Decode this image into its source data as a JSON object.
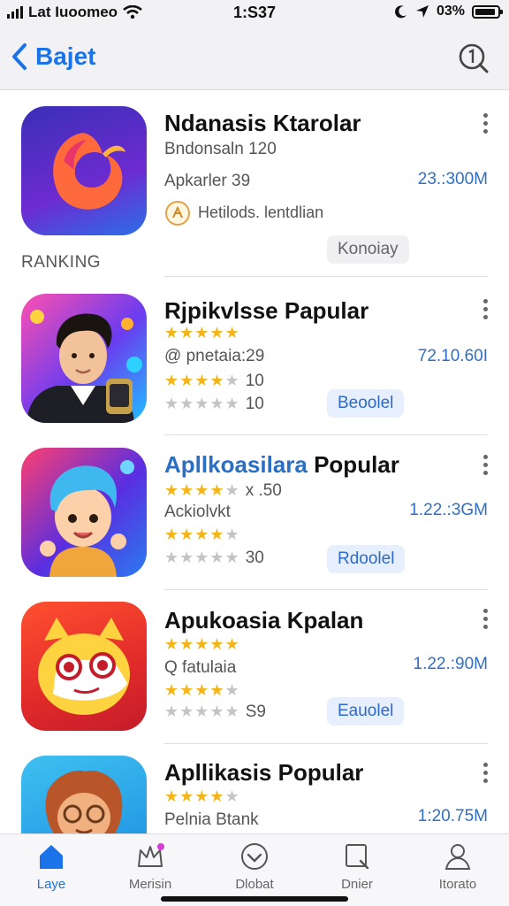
{
  "status_bar": {
    "carrier": "Lat Iuoomeo",
    "time": "1:S37",
    "battery": "03%"
  },
  "nav": {
    "back_label": "Bajet"
  },
  "featured": {
    "title": "Ndanasis Ktarolar",
    "subtitle": "Bndonsaln 120",
    "meta": "Apkarler 39",
    "size": "23.:300M",
    "developer": "Hetilods. lentdlian",
    "chip": "Konoiay"
  },
  "section_label": "RANKING",
  "apps": [
    {
      "title_prefix": "",
      "title_main": "Rjpikvlsse Papular",
      "line1_count": "",
      "sub": "@ pnetaia:29",
      "size": "72.10.60I",
      "line3_count": "10",
      "line4_count": "10",
      "chip": "Beoolel"
    },
    {
      "title_prefix": "Apllkoasilara",
      "title_main": " Popular",
      "line1_count": "x .50",
      "sub": "Ackiolvkt",
      "size": "1.22.:3GM",
      "line3_count": "",
      "line4_count": "30",
      "chip": "Rdoolel"
    },
    {
      "title_prefix": "",
      "title_main": "Apukoasia Kpalan",
      "line1_count": "",
      "sub": "Q fatulaia",
      "size": "1.22.:90M",
      "line3_count": "",
      "line4_count": "S9",
      "chip": "Eauolel"
    },
    {
      "title_prefix": "",
      "title_main": "Apllikasis Popular",
      "line1_count": "",
      "sub": "Pelnia Btank",
      "size": "1:20.75M",
      "line3_count": "",
      "line4_count": "",
      "chip": ""
    }
  ],
  "tabs": [
    {
      "label": "Laye",
      "icon": "home-icon"
    },
    {
      "label": "Merisin",
      "icon": "crown-icon"
    },
    {
      "label": "Dlobat",
      "icon": "heart-icon"
    },
    {
      "label": "Dnier",
      "icon": "folder-icon"
    },
    {
      "label": "Itorato",
      "icon": "person-icon"
    }
  ],
  "colors": {
    "accent": "#1a73e8",
    "star": "#f3b519",
    "chip_bg": "#e6effb"
  }
}
